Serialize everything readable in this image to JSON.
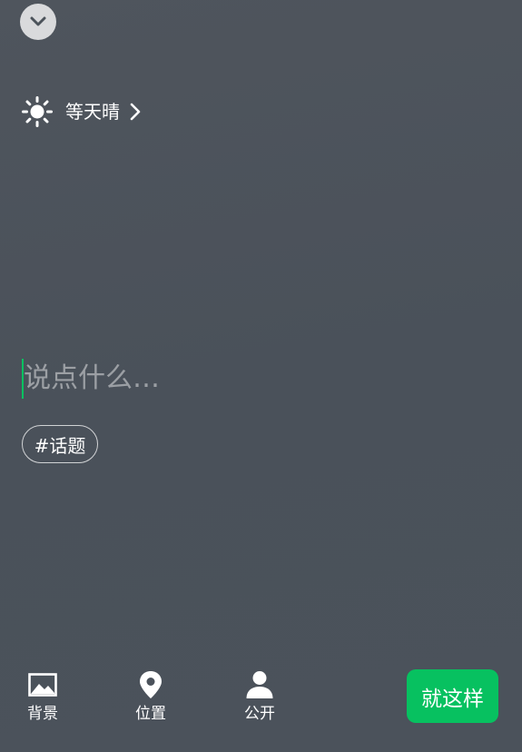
{
  "header": {
    "collapse_icon": "chevron-down-icon"
  },
  "weather": {
    "icon": "sun-icon",
    "label": "等天晴"
  },
  "compose": {
    "placeholder": "说点什么…",
    "value": ""
  },
  "topic": {
    "label": "#话题"
  },
  "toolbar": {
    "background": {
      "icon": "image-icon",
      "label": "背景"
    },
    "location": {
      "icon": "location-pin-icon",
      "label": "位置"
    },
    "visibility": {
      "icon": "person-icon",
      "label": "公开"
    },
    "submit_label": "就这样"
  },
  "colors": {
    "accent": "#07c160",
    "background": "#4c535b"
  }
}
